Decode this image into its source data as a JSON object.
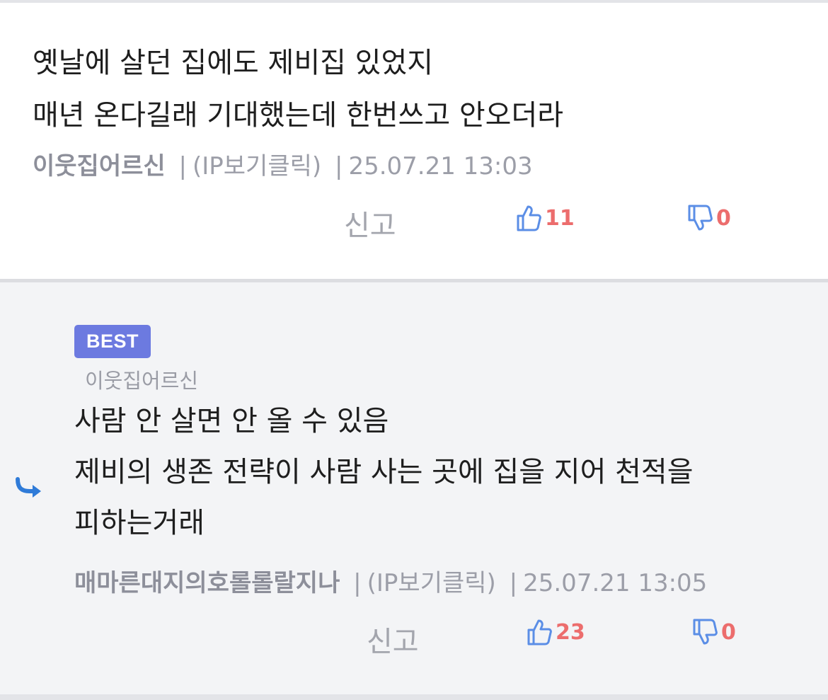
{
  "comments": [
    {
      "lines": [
        "옛날에 살던 집에도 제비집 있었지",
        "매년 온다길래 기대했는데 한번쓰고 안오더라"
      ],
      "author": "이웃집어르신",
      "ip": "(IP보기클릭)",
      "time": "25.07.21 13:03",
      "report_label": "신고",
      "likes": "11",
      "dislikes": "0"
    },
    {
      "badge": "BEST",
      "reply_to": "이웃집어르신",
      "lines": [
        "사람 안 살면 안 올 수 있음",
        "제비의 생존 전략이 사람 사는 곳에 집을 지어 천적을",
        "피하는거래"
      ],
      "author": "매마른대지의호롤롤랄지나",
      "ip": "(IP보기클릭)",
      "time": "25.07.21 13:05",
      "report_label": "신고",
      "likes": "23",
      "dislikes": "0"
    }
  ],
  "meta_separator": "|",
  "icons": {
    "thumbs_up": "thumbs-up-icon",
    "thumbs_down": "thumbs-down-icon",
    "reply": "reply-arrow-icon"
  },
  "colors": {
    "badge": "#6c7ae0",
    "vote_count": "#ec6d6d",
    "thumb_icon": "#5b8ee6",
    "reply_arrow": "#2f7bd8"
  }
}
